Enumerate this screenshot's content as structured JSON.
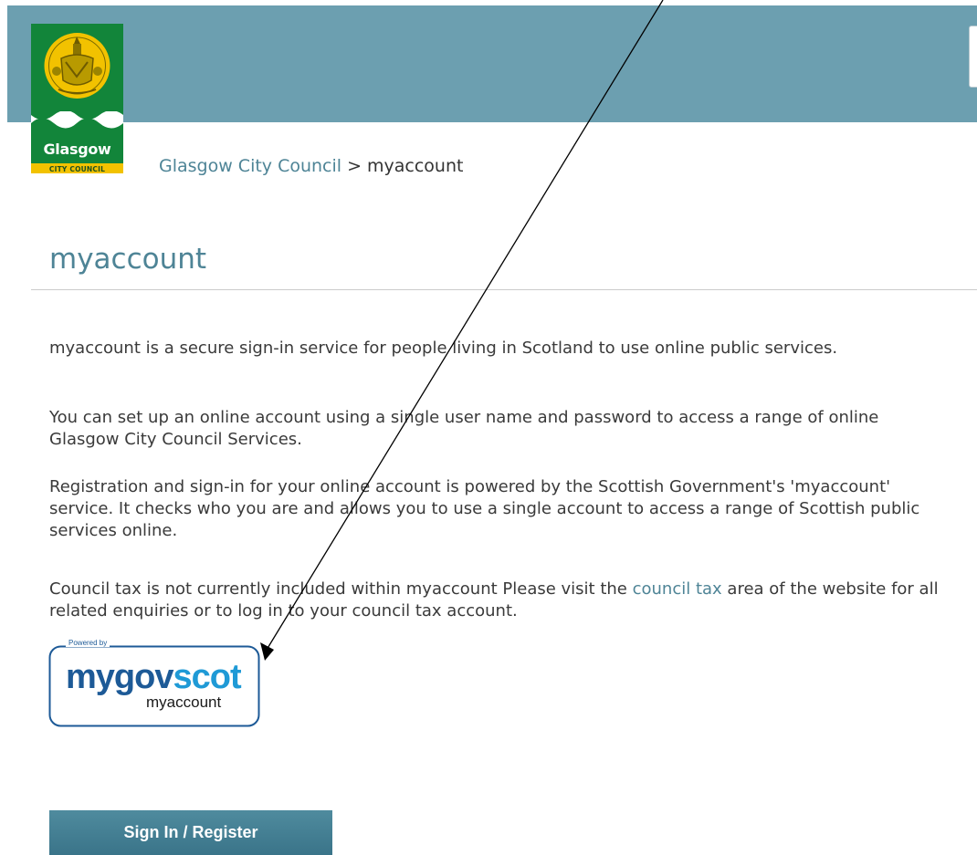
{
  "logo": {
    "name": "Glasgow",
    "subtitle": "CITY COUNCIL",
    "colors": {
      "green": "#12853a",
      "gold": "#f2c200",
      "white": "#ffffff"
    }
  },
  "breadcrumb": {
    "home": "Glasgow City Council",
    "separator": ">",
    "current": "myaccount"
  },
  "page": {
    "title": "myaccount",
    "paragraphs": [
      "myaccount is a secure sign-in service for people living in Scotland to use online public services.",
      "You can set up an online account using a single user name and password to access a range of online Glasgow City Council Services.",
      "Registration and sign-in for your online account is powered by the Scottish Government's 'myaccount' service.  It checks who you are and allows you to use a single account to access a range of Scottish public services online."
    ],
    "council_tax": {
      "before": "Council tax is not currently included within myaccount  Please visit the ",
      "link": "council tax",
      "after": " area of the website for all related enquiries or to log in to your council tax account."
    }
  },
  "badge": {
    "powered_by": "Powered by",
    "brand_my": "my",
    "brand_gov": "gov",
    "brand_scot": "scot",
    "subtext": "myaccount"
  },
  "actions": {
    "signin_label": "Sign In / Register"
  },
  "colors": {
    "header": "#6c9fb0",
    "link": "#4e8496",
    "button": "#3f7b8f",
    "badge_blue": "#1d5a97"
  }
}
